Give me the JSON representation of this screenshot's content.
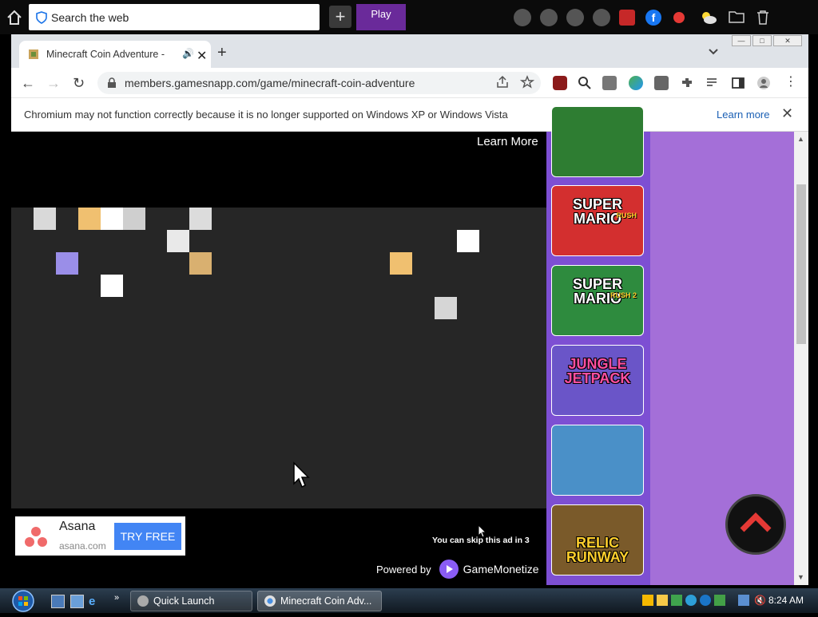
{
  "desktop_toolbar": {
    "search_text": "Search the web",
    "play_label": "Play"
  },
  "browser": {
    "tab_title": "Minecraft Coin Adventure - P",
    "url": "members.gamesnapp.com/game/minecraft-coin-adventure",
    "infobar_message": "Chromium may not function correctly because it is no longer supported on Windows XP or Windows Vista",
    "infobar_link": "Learn more"
  },
  "game": {
    "learn_more": "Learn More",
    "blocks": [
      {
        "color": "#d9d9d9"
      },
      {
        "color": "#f0c070"
      },
      {
        "color": "#ffffff"
      },
      {
        "color": "#cfcfcf"
      },
      {
        "color": "#dcdcdc"
      },
      {
        "color": "#e9e9e9"
      },
      {
        "color": "#ffffff"
      },
      {
        "color": "#9a8ee8"
      },
      {
        "color": "#d9b070"
      },
      {
        "color": "#f0c070"
      },
      {
        "color": "#ffffff"
      },
      {
        "color": "#d6d6d6"
      }
    ],
    "ad": {
      "name": "Asana",
      "domain": "asana.com",
      "cta": "TRY FREE"
    },
    "skip_text": "You can skip this ad in 3",
    "powered_by": "Powered by",
    "powered_brand": "GameMonetize"
  },
  "sidebar_games": [
    {
      "title": "",
      "subtitle": "",
      "bg": "#2e7d32"
    },
    {
      "title": "SUPER MARIO",
      "subtitle": "RUSH",
      "bg": "#d32f2f"
    },
    {
      "title": "SUPER MARIO",
      "subtitle": "RUSH 2",
      "bg": "#2e8b3e"
    },
    {
      "title": "JUNGLE JETPACK",
      "subtitle": "",
      "bg": "#6a55c8"
    },
    {
      "title": "",
      "subtitle": "",
      "bg": "#4a90c8"
    },
    {
      "title": "RELIC RUNWAY",
      "subtitle": "",
      "bg": "#7a5a2a"
    }
  ],
  "taskbar": {
    "quick_launch": "Quick Launch",
    "active_window": "Minecraft Coin Adv...",
    "clock": "8:24 AM"
  }
}
